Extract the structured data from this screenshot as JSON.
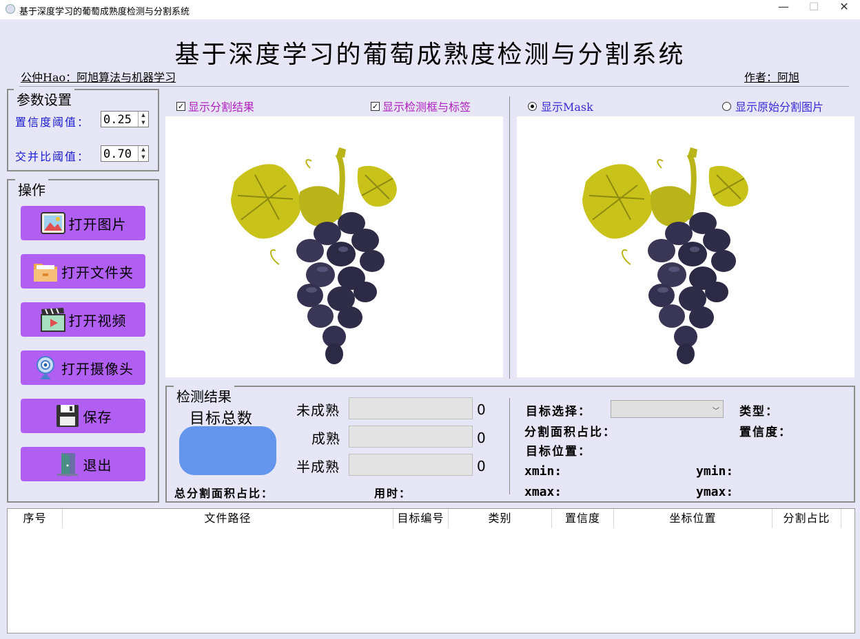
{
  "window": {
    "title": "基于深度学习的葡萄成熟度检测与分割系统",
    "minimize": "—",
    "maximize": "☐",
    "close": "✕"
  },
  "header": {
    "title": "基于深度学习的葡萄成熟度检测与分割系统",
    "left_note": "公仲Hao：阿旭算法与机器学习",
    "right_note": "作者：阿旭"
  },
  "params": {
    "title": "参数设置",
    "confidence_label": "置信度阈值：",
    "confidence_value": "0.25",
    "iou_label": "交并比阈值：",
    "iou_value": "0.70"
  },
  "operations": {
    "title": "操作",
    "buttons": [
      {
        "label": "打开图片",
        "icon": "image-icon"
      },
      {
        "label": "打开文件夹",
        "icon": "folder-icon"
      },
      {
        "label": "打开视频",
        "icon": "video-icon"
      },
      {
        "label": "打开摄像头",
        "icon": "camera-icon"
      },
      {
        "label": "保存",
        "icon": "save-icon"
      },
      {
        "label": "退出",
        "icon": "exit-icon"
      }
    ]
  },
  "display_options": {
    "show_segmentation": {
      "label": "显示分割结果",
      "checked": true
    },
    "show_boxes": {
      "label": "显示检测框与标签",
      "checked": true
    },
    "show_mask": {
      "label": "显示Mask",
      "selected": true
    },
    "show_original": {
      "label": "显示原始分割图片",
      "selected": false
    }
  },
  "results": {
    "title": "检测结果",
    "total_label": "目标总数",
    "unripe_label": "未成熟",
    "unripe_count": "0",
    "ripe_label": "成熟",
    "ripe_count": "0",
    "half_label": "半成熟",
    "half_count": "0",
    "total_area_label": "总分割面积占比：",
    "time_label": "用时：",
    "target_select_label": "目标选择：",
    "type_label": "类型：",
    "area_ratio_label": "分割面积占比：",
    "confidence_label": "置信度：",
    "position_label": "目标位置：",
    "xmin_label": "xmin:",
    "ymin_label": "ymin:",
    "xmax_label": "xmax:",
    "ymax_label": "ymax:"
  },
  "table": {
    "columns": [
      "序号",
      "文件路径",
      "目标编号",
      "类别",
      "置信度",
      "坐标位置",
      "分割占比"
    ],
    "rows": []
  },
  "colors": {
    "background": "#e6e6f6",
    "button": "#b05ff2",
    "total_badge": "#6495ed",
    "label_blue": "#1a1ad0",
    "checkbox_text": "#b020c0",
    "radio_text": "#3a2ad8"
  }
}
